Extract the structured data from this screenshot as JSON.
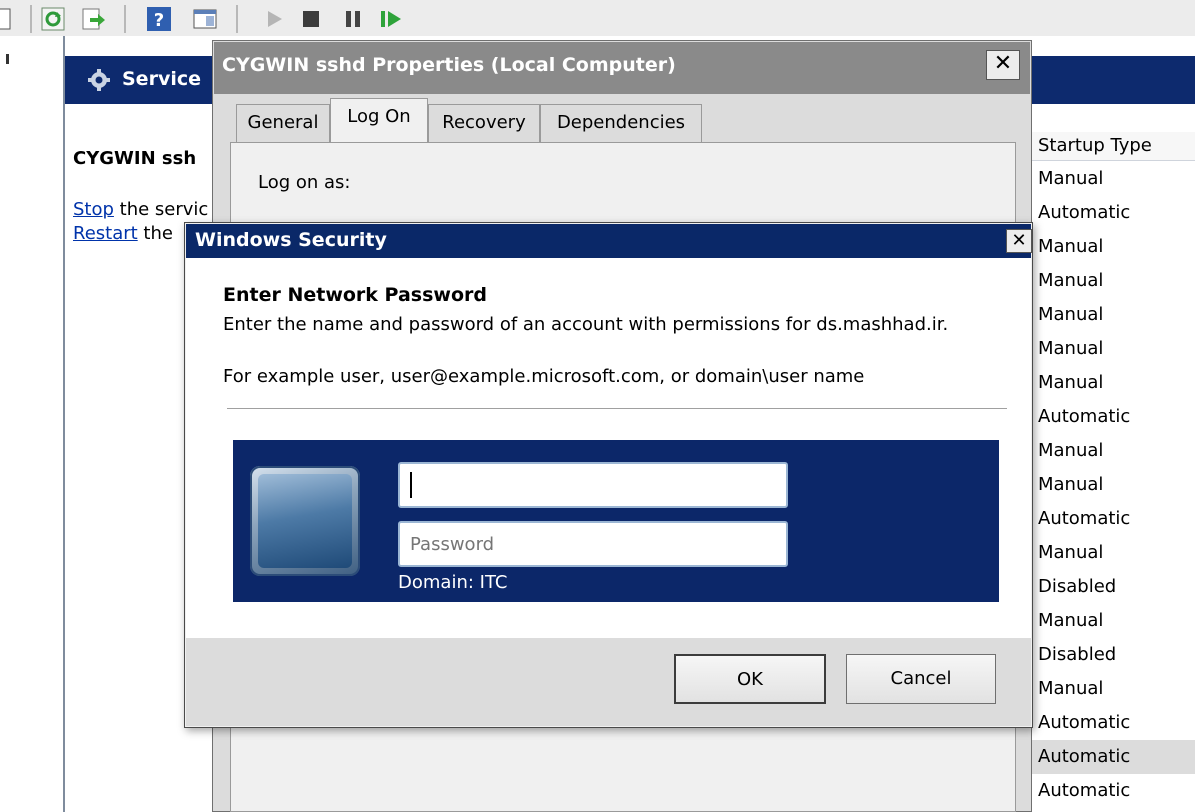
{
  "toolbar": {
    "icons": [
      "console-tree-icon",
      "refresh-icon",
      "export-list-icon",
      "help-icon",
      "action-pane-icon",
      "start-service-icon",
      "stop-service-icon",
      "pause-service-icon",
      "restart-service-icon"
    ]
  },
  "services_pane": {
    "title": "Service",
    "service_name": "CYGWIN ssh",
    "stop_link": "Stop",
    "stop_rest": " the servic",
    "restart_link": "Restart",
    "restart_rest": " the"
  },
  "service_list": {
    "column_header": "Startup Type",
    "rows": [
      "Manual",
      "Automatic",
      "Manual",
      "Manual",
      "Manual",
      "Manual",
      "Manual",
      "Automatic",
      "Manual",
      "Manual",
      "Automatic",
      "Manual",
      "Disabled",
      "Manual",
      "Disabled",
      "Manual",
      "Automatic",
      "Automatic",
      "Automatic"
    ],
    "selected_row_index": 17
  },
  "properties_window": {
    "title": "CYGWIN sshd Properties (Local Computer)",
    "close_glyph": "✕",
    "tabs": [
      "General",
      "Log On",
      "Recovery",
      "Dependencies"
    ],
    "active_tab": "Log On",
    "log_on_as_label": "Log on as:"
  },
  "security_dialog": {
    "title": "Windows Security",
    "close_glyph": "✕",
    "heading": "Enter Network Password",
    "description": "Enter the name and password of an account with permissions for ds.mashhad.ir.",
    "example": "For example user, user@example.microsoft.com, or domain\\user name",
    "username_value": "",
    "password_placeholder": "Password",
    "domain_label": "Domain: ITC",
    "ok_label": "OK",
    "cancel_label": "Cancel"
  },
  "colors": {
    "title_bar_blue": "#0a2868",
    "credential_tile": "#0c2769",
    "inactive_title": "#8a8a8a"
  }
}
